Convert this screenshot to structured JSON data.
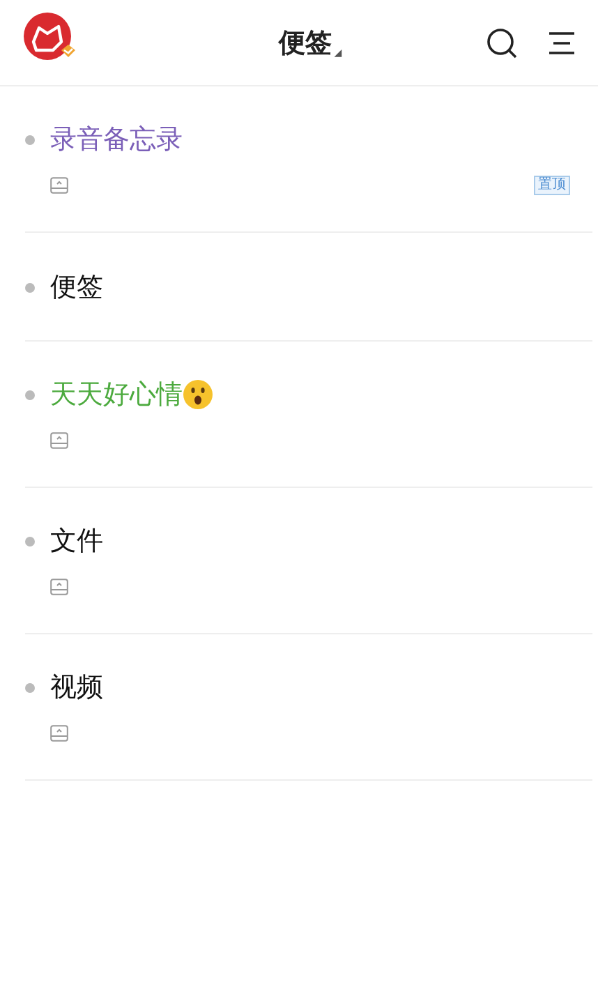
{
  "header": {
    "title": "便签",
    "dropdown_mark": "◢"
  },
  "notes": [
    {
      "kind": "note",
      "title": "录音备忘录",
      "color": "#7b5fb8",
      "emoji": false,
      "badge": "置顶"
    },
    {
      "kind": "group",
      "title": "便签",
      "color": "#111111",
      "emoji": false
    },
    {
      "kind": "note",
      "title": "天天好心情",
      "color": "#4caa3e",
      "emoji": true
    },
    {
      "kind": "note",
      "title": "文件",
      "color": "#111111",
      "emoji": false
    },
    {
      "kind": "note",
      "title": "视频",
      "color": "#111111",
      "emoji": false
    }
  ]
}
